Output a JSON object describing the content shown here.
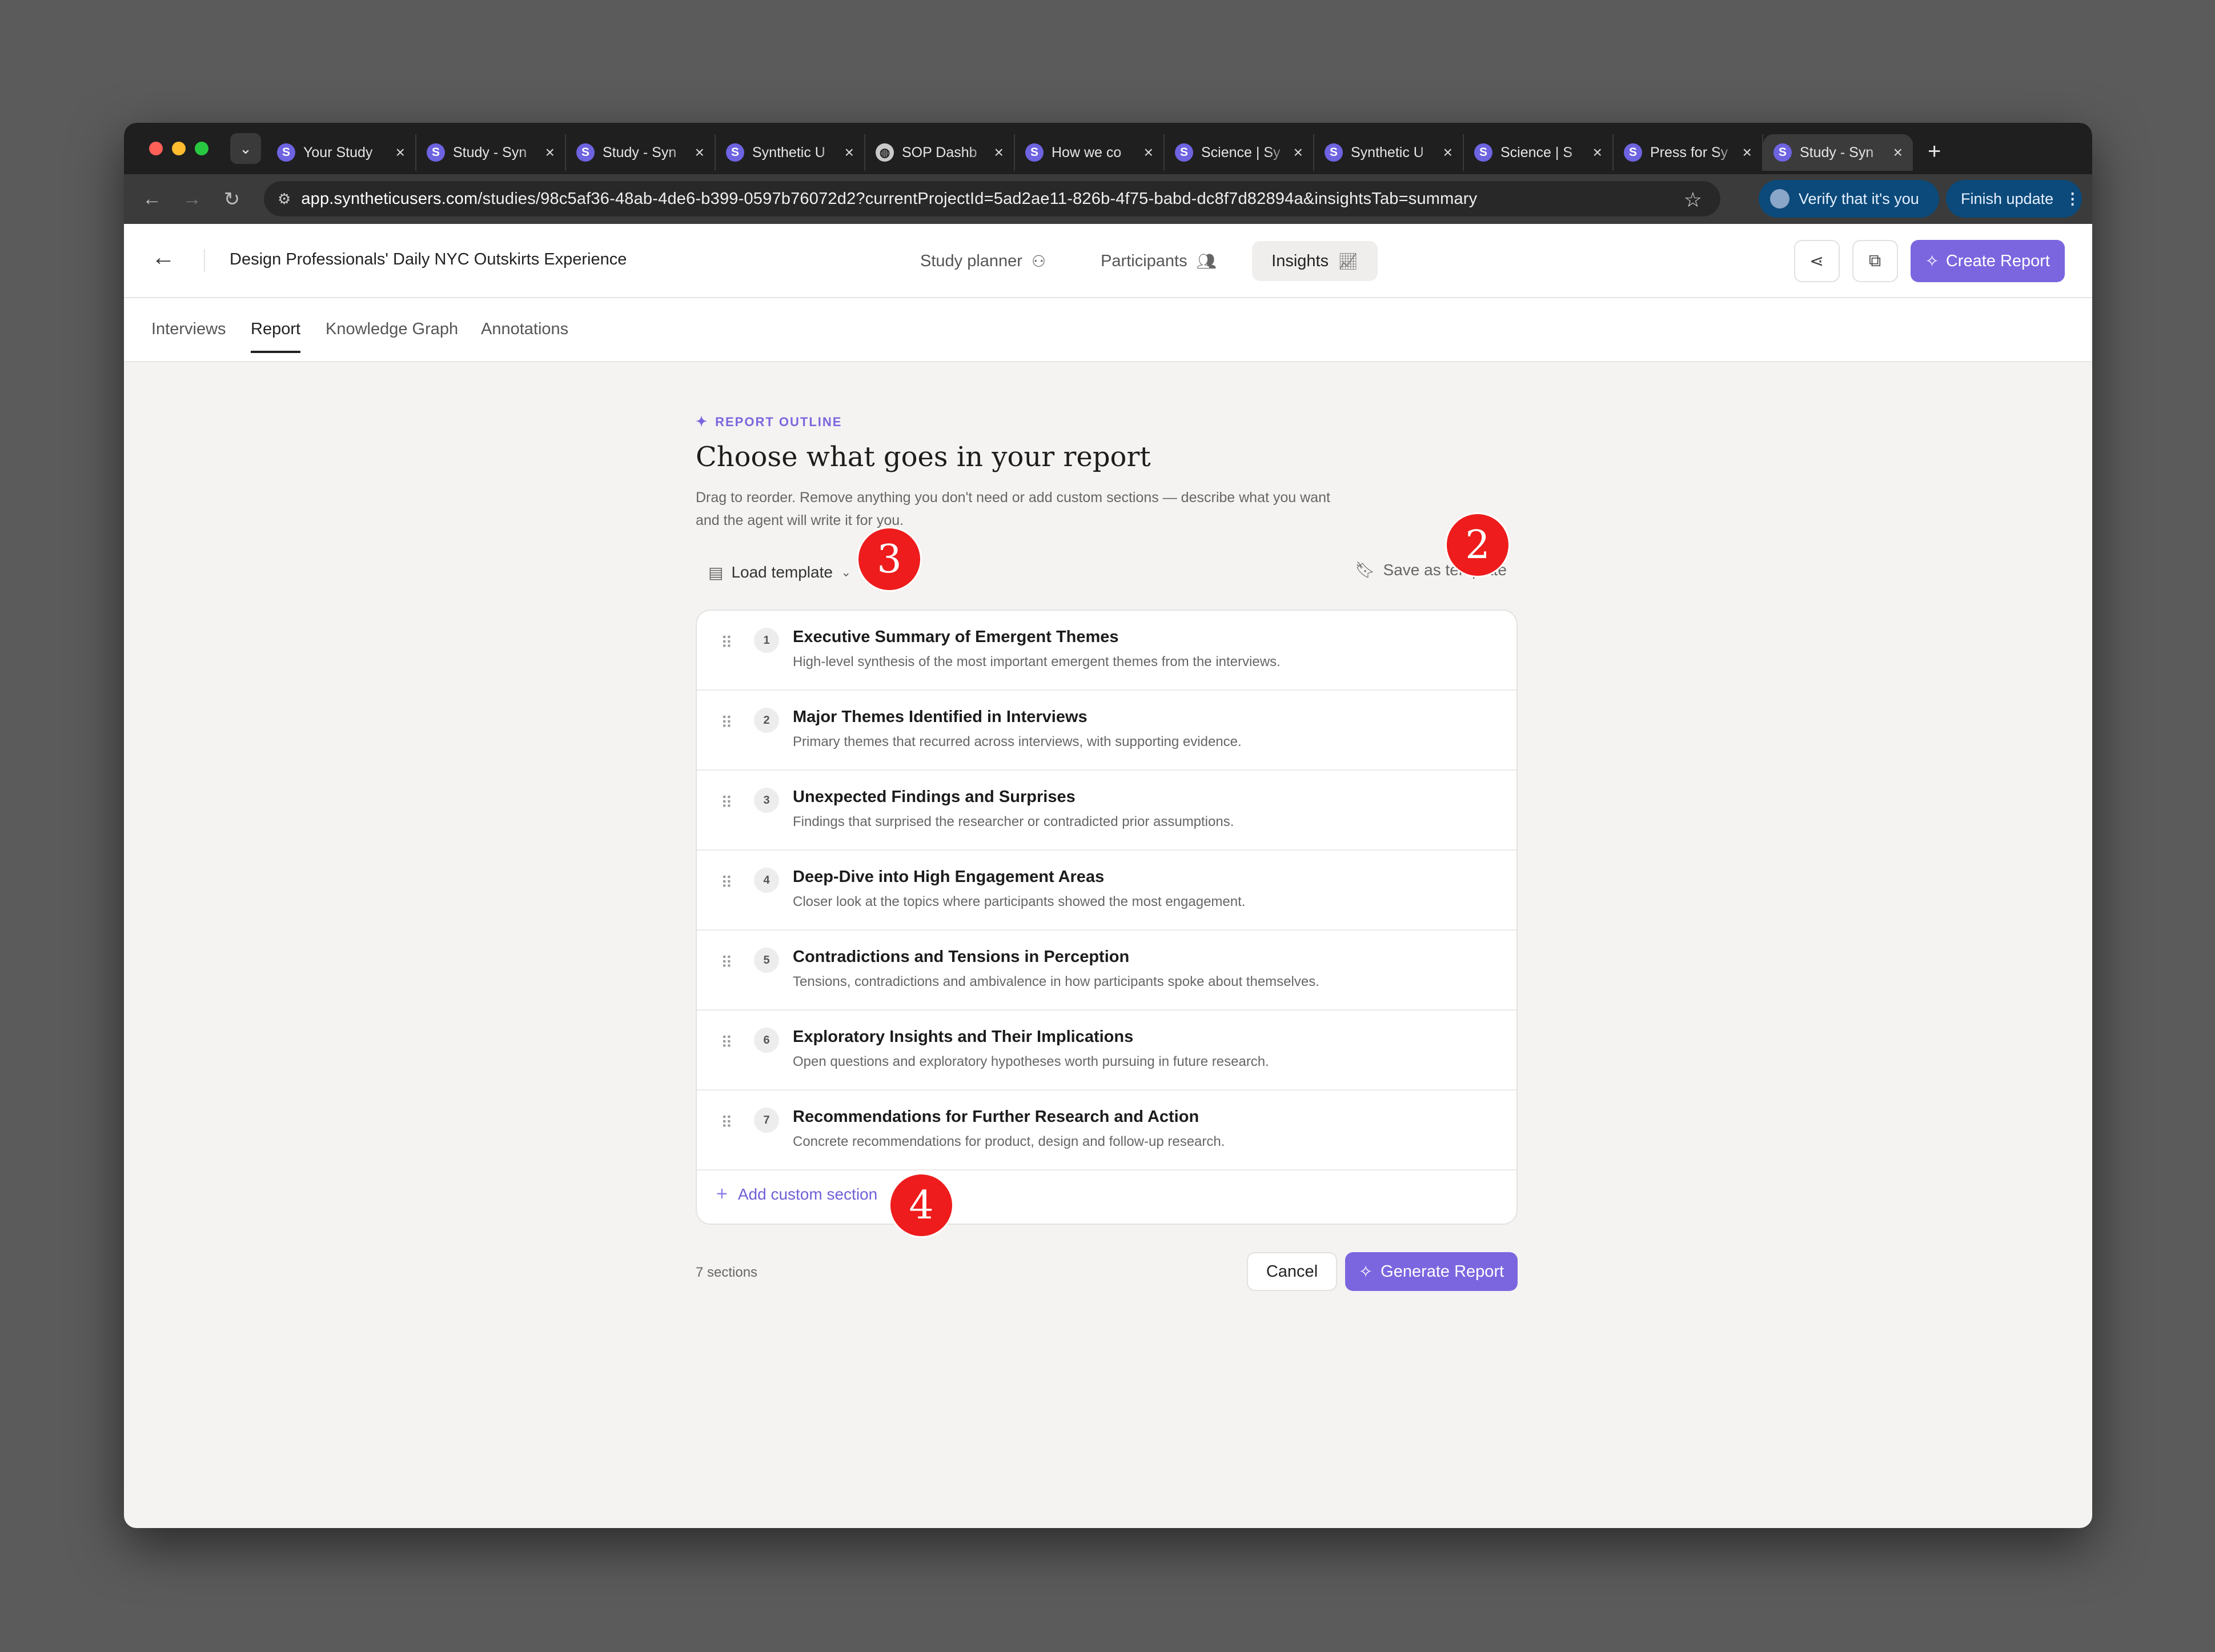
{
  "browser": {
    "tabs": [
      {
        "label": "Your Study",
        "favicon": "S",
        "active": false
      },
      {
        "label": "Study - Syn",
        "favicon": "S",
        "active": false
      },
      {
        "label": "Study - Syn",
        "favicon": "S",
        "active": false
      },
      {
        "label": "Synthetic U",
        "favicon": "S",
        "active": false
      },
      {
        "label": "SOP Dashb",
        "favicon": "globe",
        "active": false
      },
      {
        "label": "How we co",
        "favicon": "S",
        "active": false
      },
      {
        "label": "Science | Sy",
        "favicon": "S",
        "active": false
      },
      {
        "label": "Synthetic U",
        "favicon": "S",
        "active": false
      },
      {
        "label": "Science | S",
        "favicon": "S",
        "active": false
      },
      {
        "label": "Press for Sy",
        "favicon": "S",
        "active": false
      },
      {
        "label": "Study - Syn",
        "favicon": "S",
        "active": true
      }
    ],
    "url_host": "app.syntheticusers.com",
    "url_path": "/studies/98c5af36-48ab-4de6-b399-0597b76072d2?currentProjectId=5ad2ae11-826b-4f75-babd-dc8f7d82894a&insightsTab=summary",
    "verify_label": "Verify that it's you",
    "finish_label": "Finish update",
    "icons": [
      "back-icon",
      "forward-icon",
      "reload-icon",
      "star-icon",
      "menu-dots-icon"
    ]
  },
  "header": {
    "study_title": "Design Professionals' Daily NYC Outskirts Experience",
    "nav": [
      {
        "label": "Study planner",
        "icon": "flow-icon",
        "active": false
      },
      {
        "label": "Participants",
        "icon": "users-icon",
        "active": false
      },
      {
        "label": "Insights",
        "icon": "chart-icon",
        "active": true
      }
    ],
    "create_report_label": "Create Report",
    "accent": "#7b66df"
  },
  "subtabs": {
    "items": [
      {
        "label": "Interviews",
        "active": false
      },
      {
        "label": "Report",
        "active": true
      },
      {
        "label": "Knowledge Graph",
        "active": false
      },
      {
        "label": "Annotations",
        "active": false
      }
    ]
  },
  "outline": {
    "eyebrow": "REPORT OUTLINE",
    "title": "Choose what goes in your report",
    "description": "Drag to reorder. Remove anything you don't need or add custom sections — describe what you want and the agent will write it for you.",
    "load_template_label": "Load template",
    "save_template_label": "Save as template",
    "sections": [
      {
        "num": "1",
        "title": "Executive Summary of Emergent Themes",
        "desc": "High-level synthesis of the most important emergent themes from the interviews."
      },
      {
        "num": "2",
        "title": "Major Themes Identified in Interviews",
        "desc": "Primary themes that recurred across interviews, with supporting evidence."
      },
      {
        "num": "3",
        "title": "Unexpected Findings and Surprises",
        "desc": "Findings that surprised the researcher or contradicted prior assumptions."
      },
      {
        "num": "4",
        "title": "Deep-Dive into High Engagement Areas",
        "desc": "Closer look at the topics where participants showed the most engagement."
      },
      {
        "num": "5",
        "title": "Contradictions and Tensions in Perception",
        "desc": "Tensions, contradictions and ambivalence in how participants spoke about themselves."
      },
      {
        "num": "6",
        "title": "Exploratory Insights and Their Implications",
        "desc": "Open questions and exploratory hypotheses worth pursuing in future research."
      },
      {
        "num": "7",
        "title": "Recommendations for Further Research and Action",
        "desc": "Concrete recommendations for product, design and follow-up research."
      }
    ],
    "add_custom_label": "Add custom section",
    "section_count": "7 sections",
    "cancel_label": "Cancel",
    "generate_label": "Generate Report"
  },
  "markers": [
    "2",
    "3",
    "4"
  ]
}
